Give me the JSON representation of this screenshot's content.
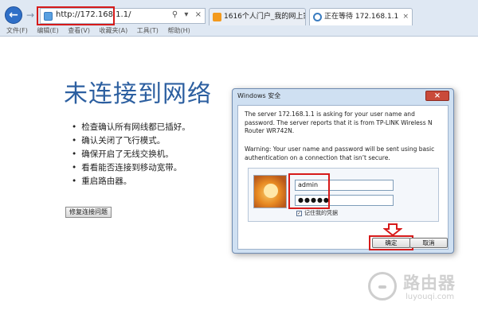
{
  "browser": {
    "address_url": "http://172.168.1.1/",
    "address_icons": [
      "⚲",
      "▾",
      "×"
    ],
    "tabs": [
      {
        "label": "1616个人门户_我的网上家园",
        "close": "×"
      },
      {
        "label": "正在等待 172.168.1.1",
        "close": "×"
      }
    ],
    "menu": [
      "文件(F)",
      "编辑(E)",
      "查看(V)",
      "收藏夹(A)",
      "工具(T)",
      "帮助(H)"
    ]
  },
  "page": {
    "title": "未连接到网络",
    "tips": [
      "检查确认所有网线都已插好。",
      "确认关闭了飞行模式。",
      "确保开启了无线交换机。",
      "看看能否连接到移动宽带。",
      "重启路由器。"
    ],
    "repair_button": "修复连接问题"
  },
  "dialog": {
    "title": "Windows 安全",
    "close": "×",
    "message": "The server 172.168.1.1 is asking for your user name and password. The server reports that it is from TP-LINK Wireless N Router WR742N.",
    "warning": "Warning: Your user name and password will be sent using basic authentication on a connection that isn’t secure.",
    "username": "admin",
    "password": "●●●●●",
    "remember_label": "记住我的凭据",
    "ok_label": "确定",
    "cancel_label": "取消"
  },
  "watermark": {
    "name": "路由器",
    "url": "luyouqi.com"
  },
  "colors": {
    "annotation": "#d61a1a",
    "title": "#2c5fa0"
  }
}
